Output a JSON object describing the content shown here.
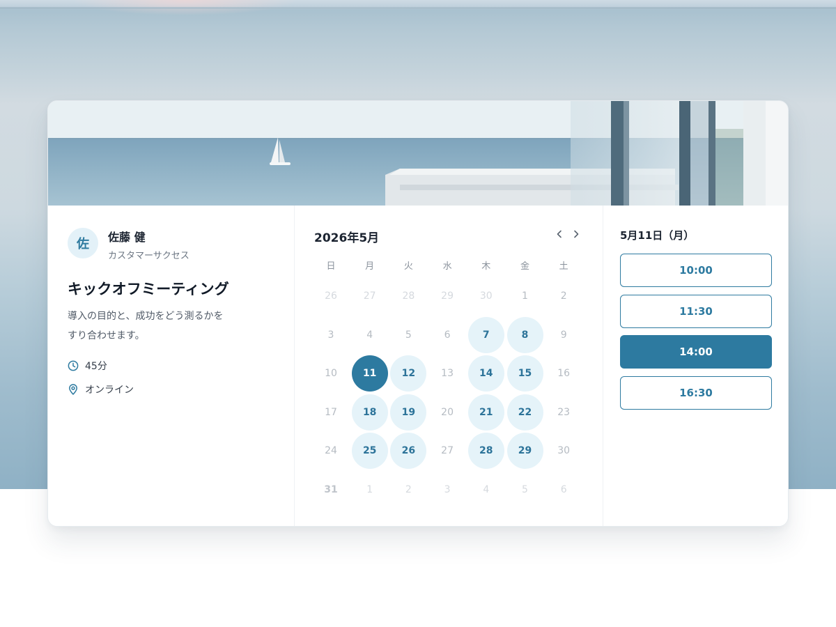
{
  "host": {
    "avatar_initial": "佐",
    "name": "佐藤 健",
    "role": "カスタマーサクセス"
  },
  "event": {
    "title": "キックオフミーティング",
    "description_line1": "導入の目的と、成功をどう測るかを",
    "description_line2": "すり合わせます。",
    "duration": "45分",
    "location": "オンライン",
    "duration_icon": "clock-icon",
    "location_icon": "map-pin-icon"
  },
  "calendar": {
    "month_label": "2026年5月",
    "prev_icon": "chevron-left-icon",
    "next_icon": "chevron-right-icon",
    "weekdays": [
      "日",
      "月",
      "火",
      "水",
      "木",
      "金",
      "土"
    ],
    "weeks": [
      [
        {
          "d": "26",
          "s": "muted"
        },
        {
          "d": "27",
          "s": "muted"
        },
        {
          "d": "28",
          "s": "muted"
        },
        {
          "d": "29",
          "s": "muted"
        },
        {
          "d": "30",
          "s": "muted"
        },
        {
          "d": "1",
          "s": "inmonth"
        },
        {
          "d": "2",
          "s": "inmonth"
        }
      ],
      [
        {
          "d": "3",
          "s": "inmonth"
        },
        {
          "d": "4",
          "s": "inmonth"
        },
        {
          "d": "5",
          "s": "inmonth"
        },
        {
          "d": "6",
          "s": "inmonth"
        },
        {
          "d": "7",
          "s": "available"
        },
        {
          "d": "8",
          "s": "available"
        },
        {
          "d": "9",
          "s": "inmonth"
        }
      ],
      [
        {
          "d": "10",
          "s": "inmonth"
        },
        {
          "d": "11",
          "s": "selected"
        },
        {
          "d": "12",
          "s": "available"
        },
        {
          "d": "13",
          "s": "inmonth"
        },
        {
          "d": "14",
          "s": "available"
        },
        {
          "d": "15",
          "s": "available"
        },
        {
          "d": "16",
          "s": "inmonth"
        }
      ],
      [
        {
          "d": "17",
          "s": "inmonth"
        },
        {
          "d": "18",
          "s": "available"
        },
        {
          "d": "19",
          "s": "available"
        },
        {
          "d": "20",
          "s": "inmonth"
        },
        {
          "d": "21",
          "s": "available"
        },
        {
          "d": "22",
          "s": "available"
        },
        {
          "d": "23",
          "s": "inmonth"
        }
      ],
      [
        {
          "d": "24",
          "s": "inmonth"
        },
        {
          "d": "25",
          "s": "available"
        },
        {
          "d": "26",
          "s": "available"
        },
        {
          "d": "27",
          "s": "inmonth"
        },
        {
          "d": "28",
          "s": "available"
        },
        {
          "d": "29",
          "s": "available"
        },
        {
          "d": "30",
          "s": "inmonth"
        }
      ],
      [
        {
          "d": "31",
          "s": "bold-muted"
        },
        {
          "d": "1",
          "s": "muted"
        },
        {
          "d": "2",
          "s": "muted"
        },
        {
          "d": "3",
          "s": "muted"
        },
        {
          "d": "4",
          "s": "muted"
        },
        {
          "d": "5",
          "s": "muted"
        },
        {
          "d": "6",
          "s": "muted"
        }
      ]
    ]
  },
  "slots": {
    "date_label": "5月11日（月）",
    "times": [
      {
        "label": "10:00",
        "active": false
      },
      {
        "label": "11:30",
        "active": false
      },
      {
        "label": "14:00",
        "active": true
      },
      {
        "label": "16:30",
        "active": false
      }
    ]
  },
  "colors": {
    "accent": "#2d7aa0",
    "available_bg": "#e5f3f9",
    "text_dark": "#1b2330"
  }
}
